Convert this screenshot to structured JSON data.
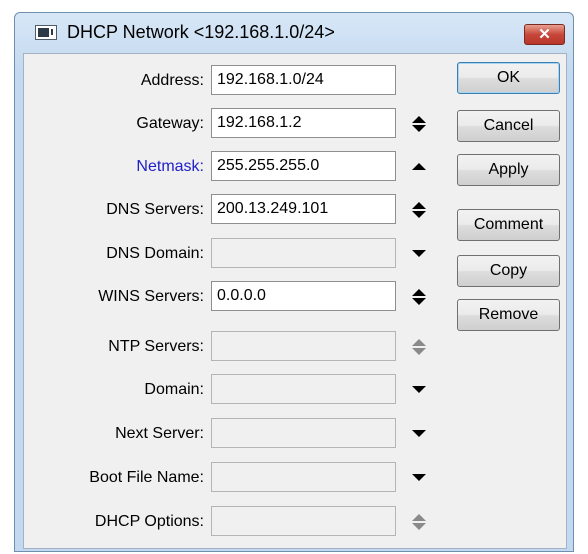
{
  "window": {
    "title": "DHCP Network <192.168.1.0/24>",
    "close_glyph": "✕"
  },
  "fields": [
    {
      "label": "Address:",
      "value": "192.168.1.0/24",
      "enabled": true,
      "spinner": "none"
    },
    {
      "label": "Gateway:",
      "value": "192.168.1.2",
      "enabled": true,
      "spinner": "updown"
    },
    {
      "label": "Netmask:",
      "value": "255.255.255.0",
      "enabled": true,
      "spinner": "up",
      "label_color": "#2020c8"
    },
    {
      "label": "DNS Servers:",
      "value": "200.13.249.101",
      "enabled": true,
      "spinner": "updown"
    },
    {
      "label": "DNS Domain:",
      "value": "",
      "enabled": false,
      "spinner": "down"
    },
    {
      "label": "WINS Servers:",
      "value": "0.0.0.0",
      "enabled": true,
      "spinner": "updown"
    },
    {
      "label": "NTP Servers:",
      "value": "",
      "enabled": false,
      "spinner": "updown-grey"
    },
    {
      "label": "Domain:",
      "value": "",
      "enabled": false,
      "spinner": "down"
    },
    {
      "label": "Next Server:",
      "value": "",
      "enabled": false,
      "spinner": "down"
    },
    {
      "label": "Boot File Name:",
      "value": "",
      "enabled": false,
      "spinner": "down"
    },
    {
      "label": "DHCP Options:",
      "value": "",
      "enabled": false,
      "spinner": "updown-grey"
    }
  ],
  "buttons": {
    "ok": "OK",
    "cancel": "Cancel",
    "apply": "Apply",
    "comment": "Comment",
    "copy": "Copy",
    "remove": "Remove"
  },
  "colors": {
    "title_gradient_top": "#d7e7f7",
    "client_bg": "#f0f0f0",
    "close_button": "#c7473a",
    "netmask_label": "#2020c8"
  }
}
